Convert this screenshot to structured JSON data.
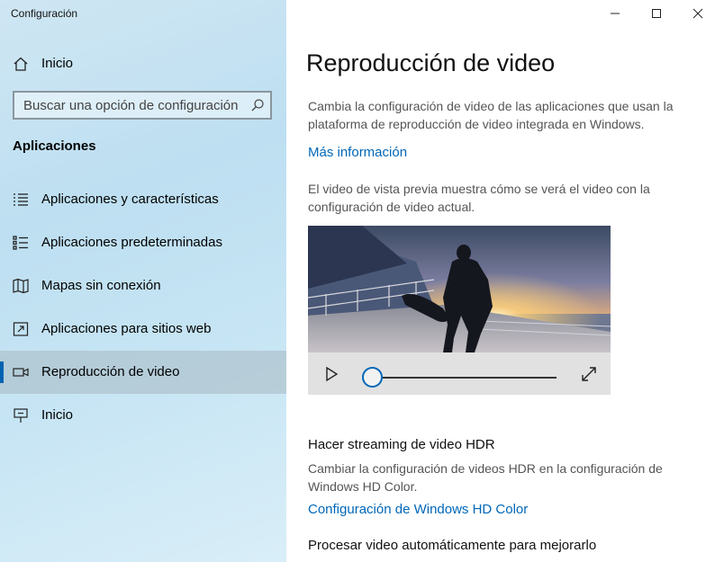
{
  "window": {
    "title": "Configuración",
    "minimize_icon": "minimize-icon",
    "maximize_icon": "maximize-icon",
    "close_icon": "close-icon"
  },
  "sidebar": {
    "home": {
      "label": "Inicio",
      "icon": "home-icon"
    },
    "search": {
      "placeholder": "Buscar una opción de configuración",
      "icon": "search-icon"
    },
    "section_title": "Aplicaciones",
    "items": [
      {
        "label": "Aplicaciones y características",
        "icon": "apps-list-icon",
        "selected": false
      },
      {
        "label": "Aplicaciones predeterminadas",
        "icon": "default-apps-icon",
        "selected": false
      },
      {
        "label": "Mapas sin conexión",
        "icon": "map-icon",
        "selected": false
      },
      {
        "label": "Aplicaciones para sitios web",
        "icon": "website-apps-icon",
        "selected": false
      },
      {
        "label": "Reproducción de video",
        "icon": "video-camera-icon",
        "selected": true
      },
      {
        "label": "Inicio",
        "icon": "startup-icon",
        "selected": false
      }
    ],
    "accent_color": "#0063b1"
  },
  "main": {
    "title": "Reproducción de video",
    "description": "Cambia la configuración de video de las aplicaciones que usan la plataforma de reproducción de video integrada en Windows.",
    "more_info_link": "Más información",
    "preview_description": "El video de vista previa muestra cómo se verá el video con la configuración de video actual.",
    "video": {
      "play_icon": "play-icon",
      "fullscreen_icon": "fullscreen-icon",
      "progress": 0
    },
    "hdr_heading": "Hacer streaming de video HDR",
    "hdr_description": "Cambiar la configuración de videos HDR en la configuración de Windows HD Color.",
    "hdr_link": "Configuración de Windows HD Color",
    "auto_process_heading": "Procesar video automáticamente para mejorarlo",
    "link_color": "#0067b8"
  }
}
